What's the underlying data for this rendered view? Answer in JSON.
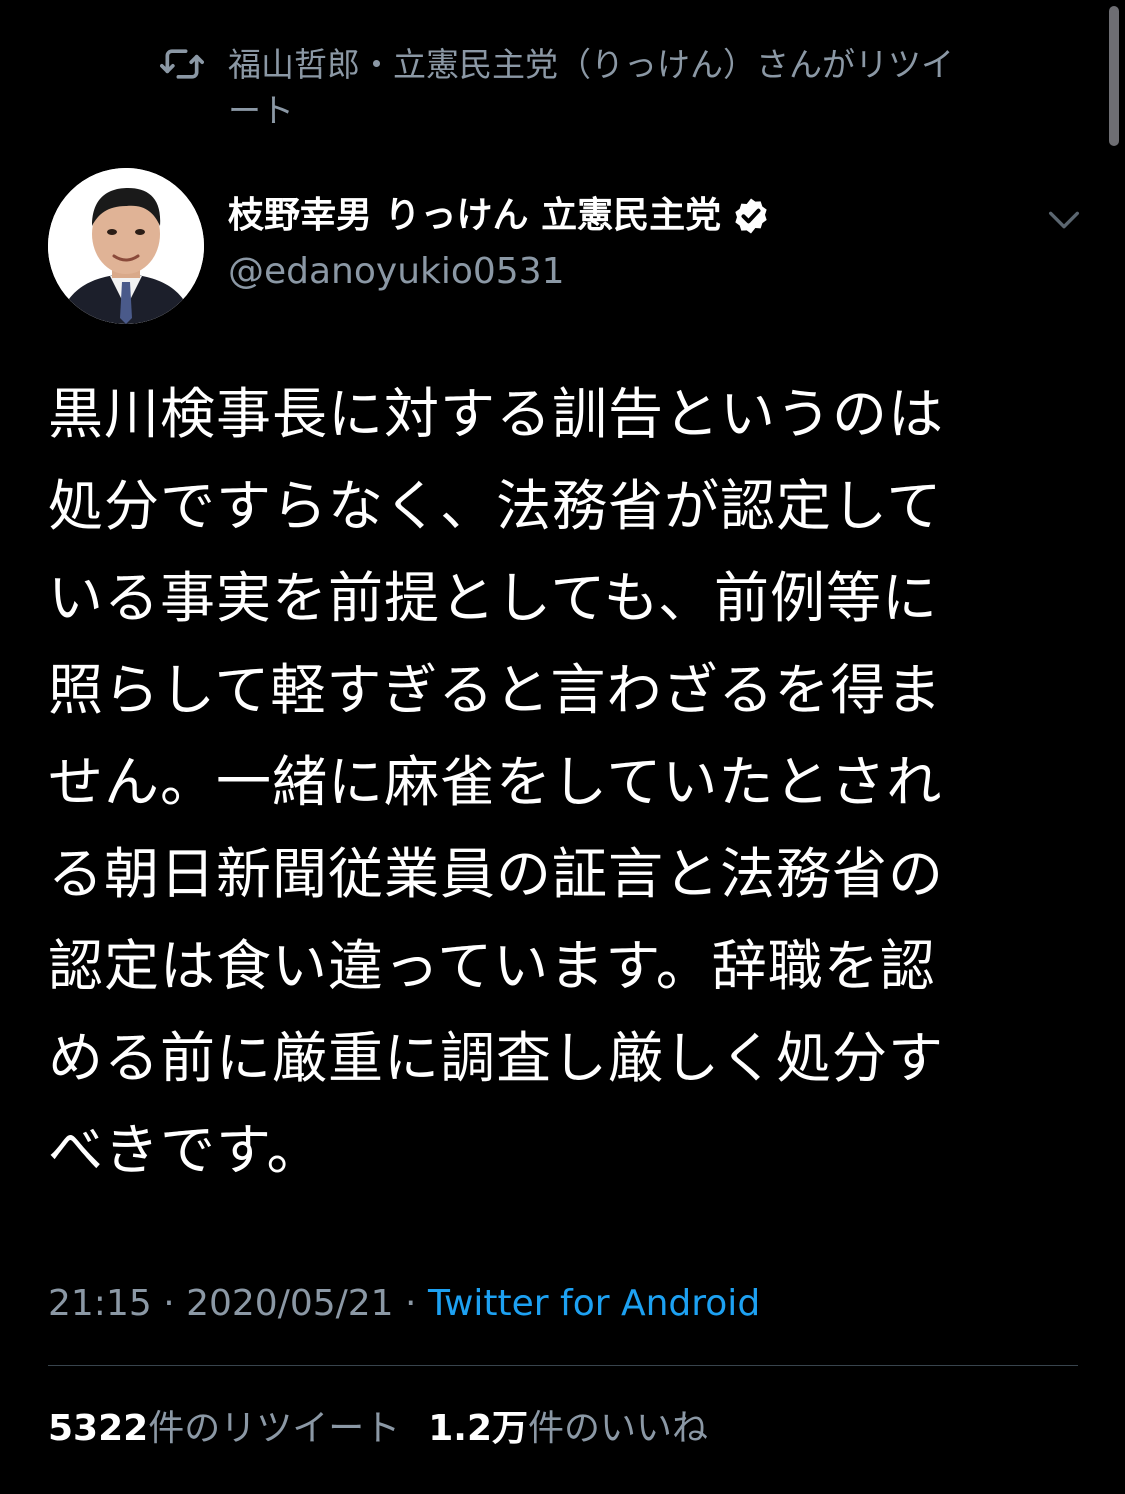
{
  "retweet_banner": {
    "icon": "retweet-icon",
    "text": "福山哲郎・立憲民主党（りっけん）さんがリツイート"
  },
  "author": {
    "display_name": "枝野幸男 りっけん 立憲民主党",
    "verified_icon": "verified-badge-icon",
    "handle": "@edanoyukio0531",
    "avatar_icon": "profile-photo"
  },
  "menu": {
    "icon": "chevron-down-icon"
  },
  "tweet": {
    "text": "黒川検事長に対する訓告というのは\n処分ですらなく、法務省が認定して\nいる事実を前提としても、前例等に\n照らして軽すぎると言わざるを得ま\nせん。一緒に麻雀をしていたとされ\nる朝日新聞従業員の証言と法務省の\n認定は食い違っています。辞職を認\nめる前に厳重に調査し厳しく処分す\nべきです。"
  },
  "meta": {
    "time": "21:15",
    "sep1": " · ",
    "date": "2020/05/21",
    "sep2": " · ",
    "source": "Twitter for Android"
  },
  "stats": {
    "retweets_count": "5322",
    "retweets_label": "件のリツイート",
    "likes_count": "1.2万",
    "likes_label": "件のいいね"
  },
  "colors": {
    "background": "#000000",
    "text_primary": "#ffffff",
    "text_secondary": "#8b98a5",
    "link": "#1da1f2",
    "divider": "#38444d"
  }
}
